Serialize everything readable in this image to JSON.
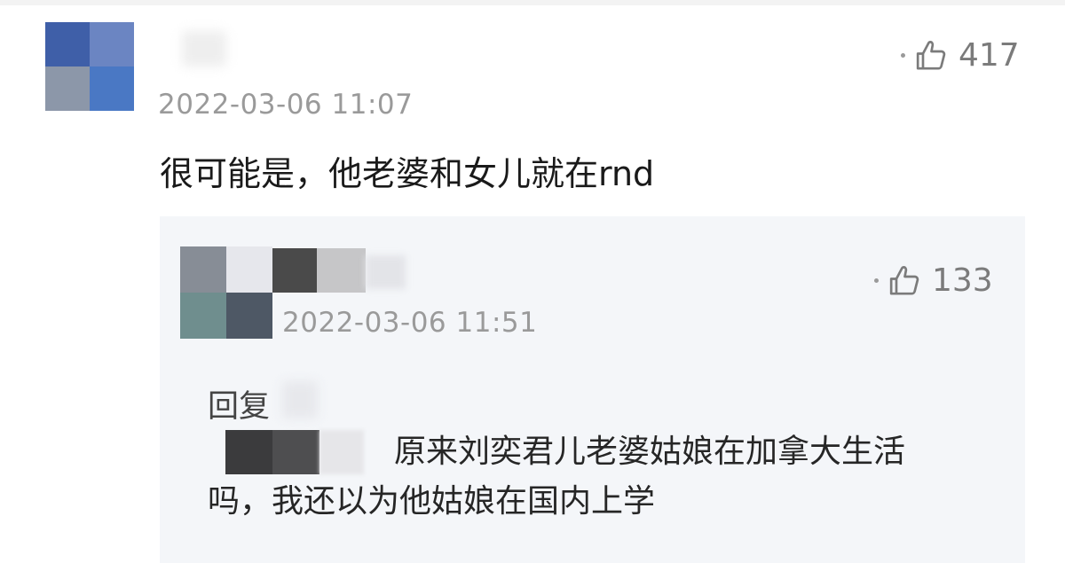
{
  "comment": {
    "timestamp": "2022-03-06 11:07",
    "likes": "417",
    "text": "很可能是，他老婆和女儿就在rnd",
    "avatar_colors": [
      "#3f5fa8",
      "#6b85c2",
      "#8c97a9",
      "#4a78c4"
    ]
  },
  "reply": {
    "timestamp": "2022-03-06 11:51",
    "likes": "133",
    "reply_label": "回复",
    "text_line1": "原来刘奕君儿老婆姑娘在加拿大生活",
    "text_line2": "吗，我还以为他姑娘在国内上学",
    "avatar_colors": [
      "#878d96",
      "#e6e7ec",
      "#6f8e8e",
      "#4e5865"
    ]
  },
  "icons": {
    "like": "thumbs-up-icon"
  }
}
